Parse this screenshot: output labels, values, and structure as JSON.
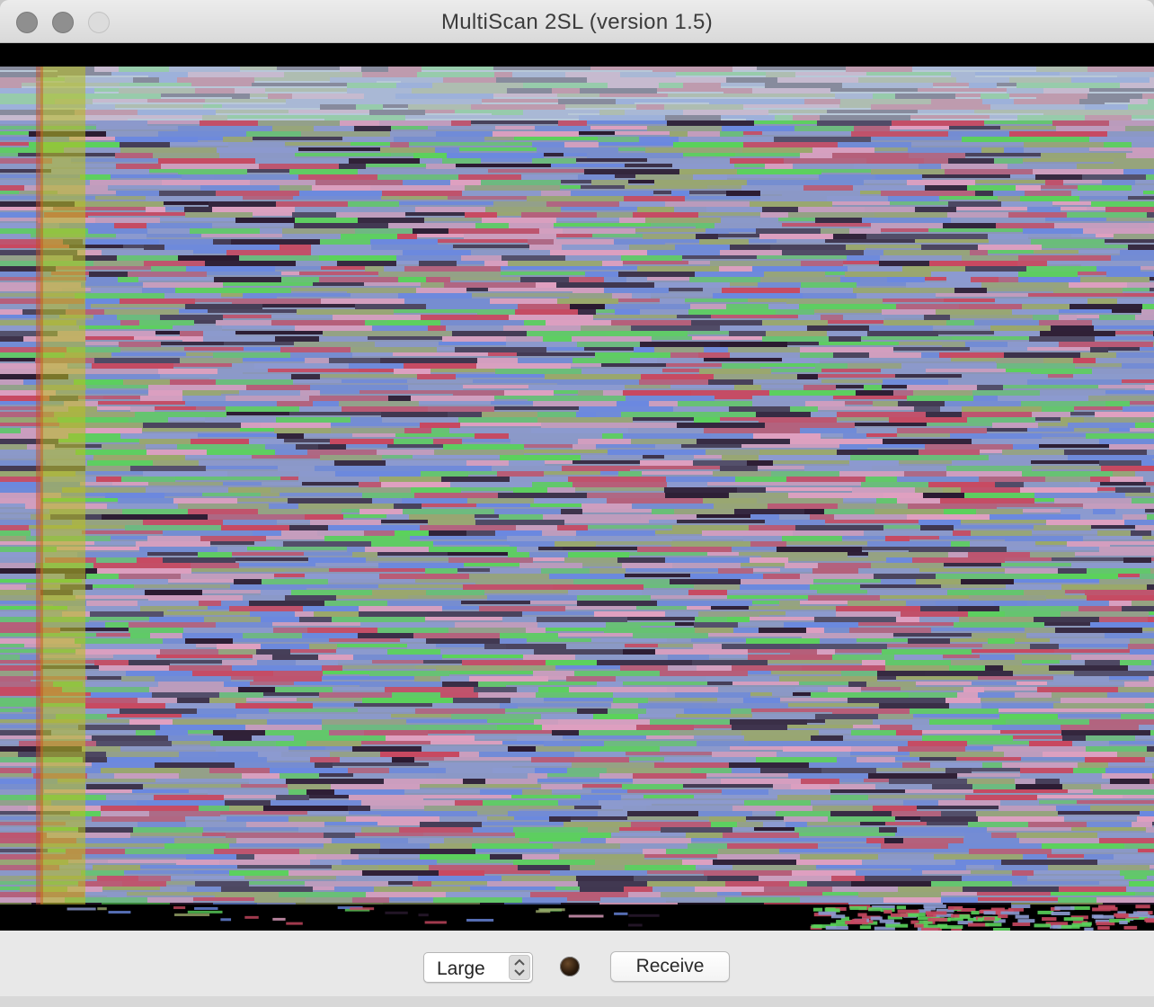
{
  "window": {
    "title": "MultiScan 2SL (version 1.5)"
  },
  "controls": {
    "size_select": {
      "selected": "Large"
    },
    "status_indicator": "dark-brown-led",
    "receive_label": "Receive"
  },
  "icons": {
    "close": "close-icon",
    "minimize": "minimize-icon",
    "zoom": "zoom-icon",
    "stepper": "up-down-chevron-icon"
  },
  "colors": {
    "scan_palette": [
      "#8c9ad0",
      "#5ad25a",
      "#c84860",
      "#2a1a30",
      "#9aa86a",
      "#6a88e0",
      "#e0a0c0"
    ]
  }
}
